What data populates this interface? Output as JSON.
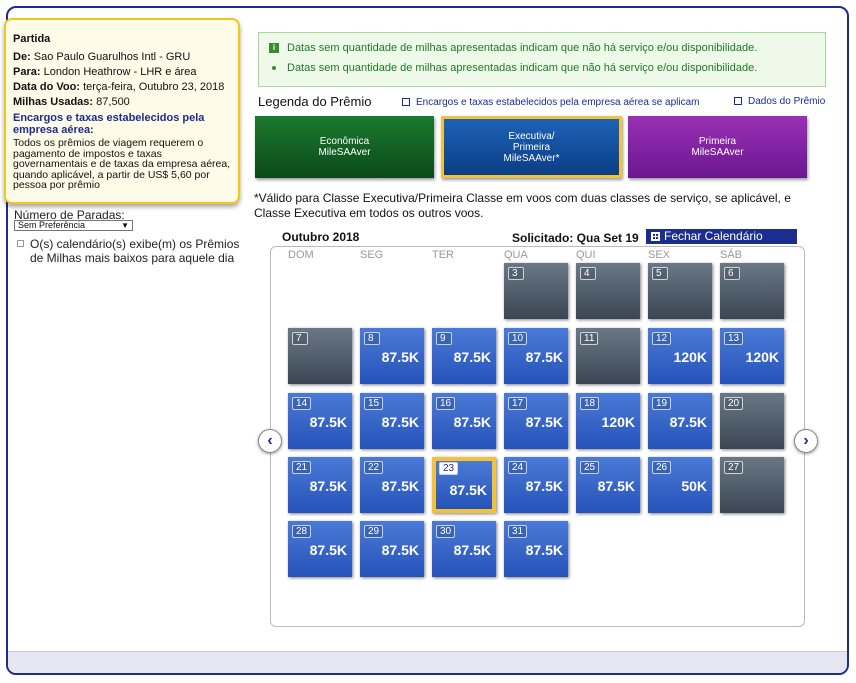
{
  "summary": {
    "title": "Partida",
    "from_label": "De:",
    "from": "Sao Paulo Guarulhos Intl - GRU",
    "to_label": "Para:",
    "to": "London Heathrow - LHR e área",
    "date_label": "Data do Voo:",
    "date": "terça-feira, Outubro 23, 2018",
    "miles_label": "Milhas Usadas:",
    "miles": "87,500",
    "fees_title": "Encargos e taxas estabelecidos pela empresa aérea:",
    "fees_text": "Todos os prêmios de viagem requerem o pagamento de impostos e taxas governamentais e de taxas da empresa aérea, quando aplicável, a partir de US$ 5,60 por pessoa por prêmio"
  },
  "filters": {
    "stops_label": "Número de Paradas:",
    "stops_value": "Sem Preferência",
    "calendar_note": "O(s) calendário(s) exibe(m) os Prêmios de Milhas mais baixos para aquele dia"
  },
  "info": {
    "line1": "Datas sem quantidade de milhas apresentadas indicam que não há serviço e/ou disponibilidade.",
    "line2": "Datas sem quantidade de milhas apresentadas indicam que não há serviço e/ou disponibilidade."
  },
  "legend": {
    "title": "Legenda do Prêmio",
    "fees_link": "Encargos e taxas estabelecidos pela empresa aérea se aplicam",
    "award_link": "Dados do Prêmio",
    "awards": [
      {
        "line1": "Econômica",
        "line2": "MileSAAver",
        "line3": ""
      },
      {
        "line1": "Executiva/",
        "line2": "Primeira",
        "line3": "MileSAAver*"
      },
      {
        "line1": "Primeira",
        "line2": "MileSAAver",
        "line3": ""
      }
    ],
    "valid_note": "*Válido para Classe Executiva/Primeira Classe em voos com duas classes de serviço, se aplicável, e Classe Executiva em todos os outros voos."
  },
  "calendar": {
    "month": "Outubro 2018",
    "requested": "Solicitado: Qua Set 19",
    "close_button": "Fechar Calendário Inteiro",
    "weekdays": [
      "DOM",
      "SEG",
      "TER",
      "QUA",
      "QUI",
      "SEX",
      "SÁB"
    ],
    "selected_day": "23",
    "days": [
      {
        "day": "3",
        "miles": ""
      },
      {
        "day": "4",
        "miles": ""
      },
      {
        "day": "5",
        "miles": ""
      },
      {
        "day": "6",
        "miles": ""
      },
      {
        "day": "7",
        "miles": ""
      },
      {
        "day": "8",
        "miles": "87.5K"
      },
      {
        "day": "9",
        "miles": "87.5K"
      },
      {
        "day": "10",
        "miles": "87.5K"
      },
      {
        "day": "11",
        "miles": ""
      },
      {
        "day": "12",
        "miles": "120K"
      },
      {
        "day": "13",
        "miles": "120K"
      },
      {
        "day": "14",
        "miles": "87.5K"
      },
      {
        "day": "15",
        "miles": "87.5K"
      },
      {
        "day": "16",
        "miles": "87.5K"
      },
      {
        "day": "17",
        "miles": "87.5K"
      },
      {
        "day": "18",
        "miles": "120K"
      },
      {
        "day": "19",
        "miles": "87.5K"
      },
      {
        "day": "20",
        "miles": ""
      },
      {
        "day": "21",
        "miles": "87.5K"
      },
      {
        "day": "22",
        "miles": "87.5K"
      },
      {
        "day": "23",
        "miles": "87.5K"
      },
      {
        "day": "24",
        "miles": "87.5K"
      },
      {
        "day": "25",
        "miles": "87.5K"
      },
      {
        "day": "26",
        "miles": "50K"
      },
      {
        "day": "27",
        "miles": ""
      },
      {
        "day": "28",
        "miles": "87.5K"
      },
      {
        "day": "29",
        "miles": "87.5K"
      },
      {
        "day": "30",
        "miles": "87.5K"
      },
      {
        "day": "31",
        "miles": "87.5K"
      }
    ]
  },
  "icons": {
    "prev": "chevron-left-icon",
    "next": "chevron-right-icon",
    "prev_glyph": "‹",
    "next_glyph": "›",
    "info_glyph": "i",
    "select_arrow": "▼"
  },
  "colors": {
    "brand_blue": "#1b2d8f",
    "available": "#3163c6",
    "not_available": "#4f5b68",
    "selected_border": "#f2c23e",
    "economy": "#146b27",
    "business": "#15509e",
    "first": "#8526a6"
  }
}
